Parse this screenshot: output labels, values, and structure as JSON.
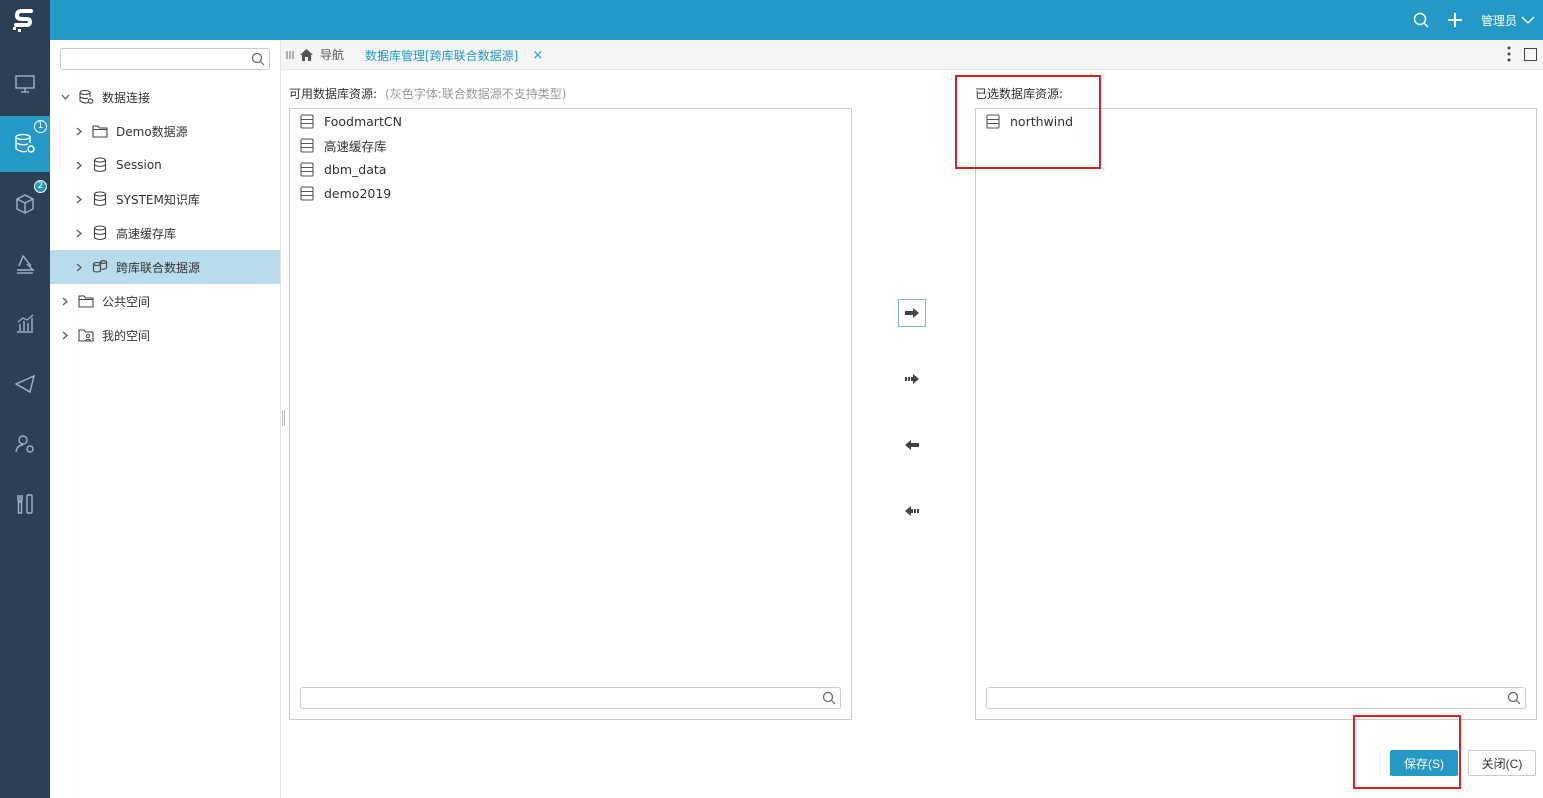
{
  "topbar": {
    "user_label": "管理员"
  },
  "rail": {
    "badges": [
      "1",
      "2"
    ]
  },
  "tree": {
    "search_placeholder": "",
    "items": [
      {
        "label": "数据连接",
        "icon": "db-connection-icon",
        "level": 0
      },
      {
        "label": "Demo数据源",
        "icon": "folder-icon",
        "level": 1
      },
      {
        "label": "Session",
        "icon": "database-icon",
        "level": 1
      },
      {
        "label": "SYSTEM知识库",
        "icon": "database-icon",
        "level": 1
      },
      {
        "label": "高速缓存库",
        "icon": "database-icon",
        "level": 1
      },
      {
        "label": "跨库联合数据源",
        "icon": "cross-database-icon",
        "level": 1
      },
      {
        "label": "公共空间",
        "icon": "folder-icon",
        "level": 0
      },
      {
        "label": "我的空间",
        "icon": "user-folder-icon",
        "level": 0
      }
    ]
  },
  "tabs": {
    "nav_label": "导航",
    "active_label": "数据库管理[跨库联合数据源]",
    "close_glyph": "×"
  },
  "available": {
    "label": "可用数据库资源:",
    "hint": "(灰色字体:联合数据源不支持类型)",
    "items": [
      "FoodmartCN",
      "高速缓存库",
      "dbm_data",
      "demo2019"
    ],
    "search_placeholder": ""
  },
  "selected": {
    "label": "已选数据库资源:",
    "items": [
      "northwind"
    ],
    "search_placeholder": ""
  },
  "footer": {
    "save_label": "保存(S)",
    "close_label": "关闭(C)"
  },
  "colors": {
    "brand": "#2599c6",
    "rail_bg": "#2b3f55",
    "selected_row": "#b8dceb",
    "highlight": "#e02020"
  }
}
